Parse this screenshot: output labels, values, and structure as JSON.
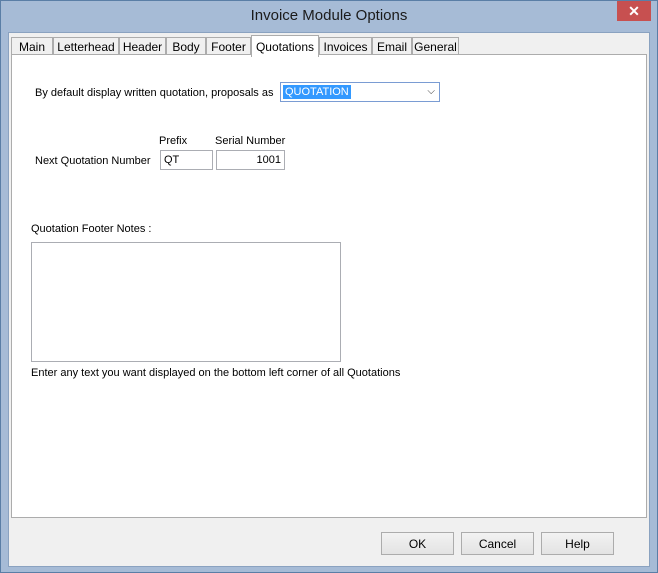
{
  "window": {
    "title": "Invoice Module Options",
    "close_glyph": "✕"
  },
  "tabs": [
    {
      "label": "Main"
    },
    {
      "label": "Letterhead"
    },
    {
      "label": "Header"
    },
    {
      "label": "Body"
    },
    {
      "label": "Footer"
    },
    {
      "label": "Quotations",
      "active": true
    },
    {
      "label": "Invoices"
    },
    {
      "label": "Email"
    },
    {
      "label": "General"
    }
  ],
  "quotations": {
    "display_label": "By default display written quotation, proposals as",
    "display_value": "QUOTATION",
    "prefix_header": "Prefix",
    "serial_header": "Serial Number",
    "next_number_label": "Next Quotation Number",
    "prefix_value": "QT",
    "serial_value": "1001",
    "footer_notes_label": "Quotation Footer Notes :",
    "footer_notes_value": "",
    "footer_hint": "Enter any text you want displayed on the bottom left corner of all Quotations"
  },
  "buttons": {
    "ok": "OK",
    "cancel": "Cancel",
    "help": "Help"
  }
}
